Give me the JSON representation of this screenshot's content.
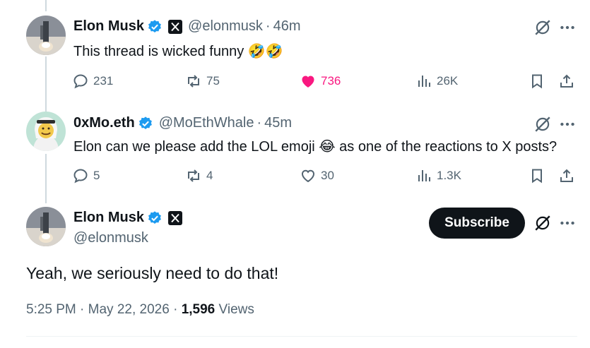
{
  "reply1": {
    "name": "Elon Musk",
    "handle": "@elonmusk",
    "time": "46m",
    "text": "This thread is wicked funny 🤣🤣",
    "replies": "231",
    "reposts": "75",
    "likes": "736",
    "views": "26K"
  },
  "reply2": {
    "name": "0xMo.eth",
    "handle": "@MoEthWhale",
    "time": "45m",
    "text": "Elon can we please add the LOL emoji 😂 as one of the reactions to X posts?",
    "replies": "5",
    "reposts": "4",
    "likes": "30",
    "views": "1.3K"
  },
  "main": {
    "name": "Elon Musk",
    "handle": "@elonmusk",
    "subscribe_label": "Subscribe",
    "text": "Yeah, we seriously need to do that!",
    "time": "5:25 PM",
    "date": "May 22, 2026",
    "views_count": "1,596",
    "views_label": "Views"
  },
  "colors": {
    "accent": "#1d9bf0",
    "like": "#f91880",
    "muted": "#536471",
    "text": "#0f1419"
  }
}
